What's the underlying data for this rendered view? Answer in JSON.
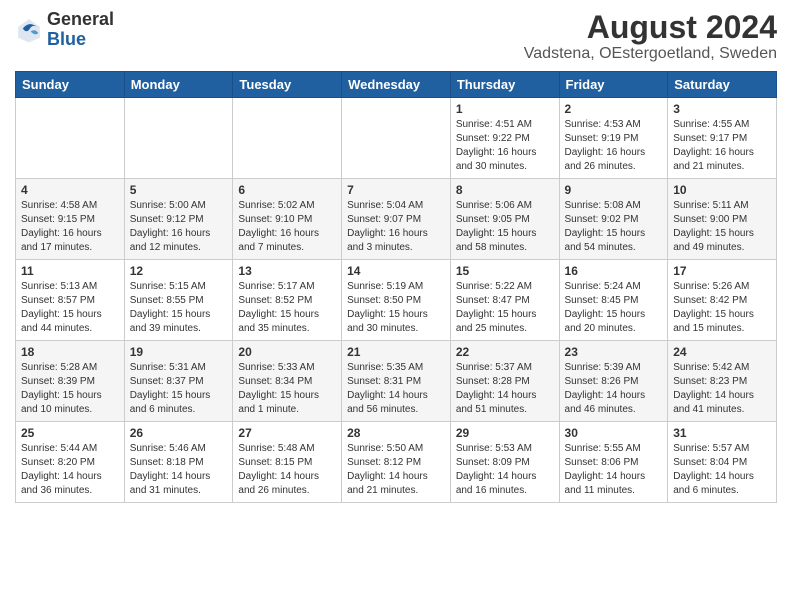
{
  "header": {
    "title": "August 2024",
    "subtitle": "Vadstena, OEstergoetland, Sweden",
    "logo_general": "General",
    "logo_blue": "Blue"
  },
  "calendar": {
    "weekdays": [
      "Sunday",
      "Monday",
      "Tuesday",
      "Wednesday",
      "Thursday",
      "Friday",
      "Saturday"
    ],
    "rows": [
      [
        {
          "day": "",
          "info": ""
        },
        {
          "day": "",
          "info": ""
        },
        {
          "day": "",
          "info": ""
        },
        {
          "day": "",
          "info": ""
        },
        {
          "day": "1",
          "info": "Sunrise: 4:51 AM\nSunset: 9:22 PM\nDaylight: 16 hours\nand 30 minutes."
        },
        {
          "day": "2",
          "info": "Sunrise: 4:53 AM\nSunset: 9:19 PM\nDaylight: 16 hours\nand 26 minutes."
        },
        {
          "day": "3",
          "info": "Sunrise: 4:55 AM\nSunset: 9:17 PM\nDaylight: 16 hours\nand 21 minutes."
        }
      ],
      [
        {
          "day": "4",
          "info": "Sunrise: 4:58 AM\nSunset: 9:15 PM\nDaylight: 16 hours\nand 17 minutes."
        },
        {
          "day": "5",
          "info": "Sunrise: 5:00 AM\nSunset: 9:12 PM\nDaylight: 16 hours\nand 12 minutes."
        },
        {
          "day": "6",
          "info": "Sunrise: 5:02 AM\nSunset: 9:10 PM\nDaylight: 16 hours\nand 7 minutes."
        },
        {
          "day": "7",
          "info": "Sunrise: 5:04 AM\nSunset: 9:07 PM\nDaylight: 16 hours\nand 3 minutes."
        },
        {
          "day": "8",
          "info": "Sunrise: 5:06 AM\nSunset: 9:05 PM\nDaylight: 15 hours\nand 58 minutes."
        },
        {
          "day": "9",
          "info": "Sunrise: 5:08 AM\nSunset: 9:02 PM\nDaylight: 15 hours\nand 54 minutes."
        },
        {
          "day": "10",
          "info": "Sunrise: 5:11 AM\nSunset: 9:00 PM\nDaylight: 15 hours\nand 49 minutes."
        }
      ],
      [
        {
          "day": "11",
          "info": "Sunrise: 5:13 AM\nSunset: 8:57 PM\nDaylight: 15 hours\nand 44 minutes."
        },
        {
          "day": "12",
          "info": "Sunrise: 5:15 AM\nSunset: 8:55 PM\nDaylight: 15 hours\nand 39 minutes."
        },
        {
          "day": "13",
          "info": "Sunrise: 5:17 AM\nSunset: 8:52 PM\nDaylight: 15 hours\nand 35 minutes."
        },
        {
          "day": "14",
          "info": "Sunrise: 5:19 AM\nSunset: 8:50 PM\nDaylight: 15 hours\nand 30 minutes."
        },
        {
          "day": "15",
          "info": "Sunrise: 5:22 AM\nSunset: 8:47 PM\nDaylight: 15 hours\nand 25 minutes."
        },
        {
          "day": "16",
          "info": "Sunrise: 5:24 AM\nSunset: 8:45 PM\nDaylight: 15 hours\nand 20 minutes."
        },
        {
          "day": "17",
          "info": "Sunrise: 5:26 AM\nSunset: 8:42 PM\nDaylight: 15 hours\nand 15 minutes."
        }
      ],
      [
        {
          "day": "18",
          "info": "Sunrise: 5:28 AM\nSunset: 8:39 PM\nDaylight: 15 hours\nand 10 minutes."
        },
        {
          "day": "19",
          "info": "Sunrise: 5:31 AM\nSunset: 8:37 PM\nDaylight: 15 hours\nand 6 minutes."
        },
        {
          "day": "20",
          "info": "Sunrise: 5:33 AM\nSunset: 8:34 PM\nDaylight: 15 hours\nand 1 minute."
        },
        {
          "day": "21",
          "info": "Sunrise: 5:35 AM\nSunset: 8:31 PM\nDaylight: 14 hours\nand 56 minutes."
        },
        {
          "day": "22",
          "info": "Sunrise: 5:37 AM\nSunset: 8:28 PM\nDaylight: 14 hours\nand 51 minutes."
        },
        {
          "day": "23",
          "info": "Sunrise: 5:39 AM\nSunset: 8:26 PM\nDaylight: 14 hours\nand 46 minutes."
        },
        {
          "day": "24",
          "info": "Sunrise: 5:42 AM\nSunset: 8:23 PM\nDaylight: 14 hours\nand 41 minutes."
        }
      ],
      [
        {
          "day": "25",
          "info": "Sunrise: 5:44 AM\nSunset: 8:20 PM\nDaylight: 14 hours\nand 36 minutes."
        },
        {
          "day": "26",
          "info": "Sunrise: 5:46 AM\nSunset: 8:18 PM\nDaylight: 14 hours\nand 31 minutes."
        },
        {
          "day": "27",
          "info": "Sunrise: 5:48 AM\nSunset: 8:15 PM\nDaylight: 14 hours\nand 26 minutes."
        },
        {
          "day": "28",
          "info": "Sunrise: 5:50 AM\nSunset: 8:12 PM\nDaylight: 14 hours\nand 21 minutes."
        },
        {
          "day": "29",
          "info": "Sunrise: 5:53 AM\nSunset: 8:09 PM\nDaylight: 14 hours\nand 16 minutes."
        },
        {
          "day": "30",
          "info": "Sunrise: 5:55 AM\nSunset: 8:06 PM\nDaylight: 14 hours\nand 11 minutes."
        },
        {
          "day": "31",
          "info": "Sunrise: 5:57 AM\nSunset: 8:04 PM\nDaylight: 14 hours\nand 6 minutes."
        }
      ]
    ]
  }
}
